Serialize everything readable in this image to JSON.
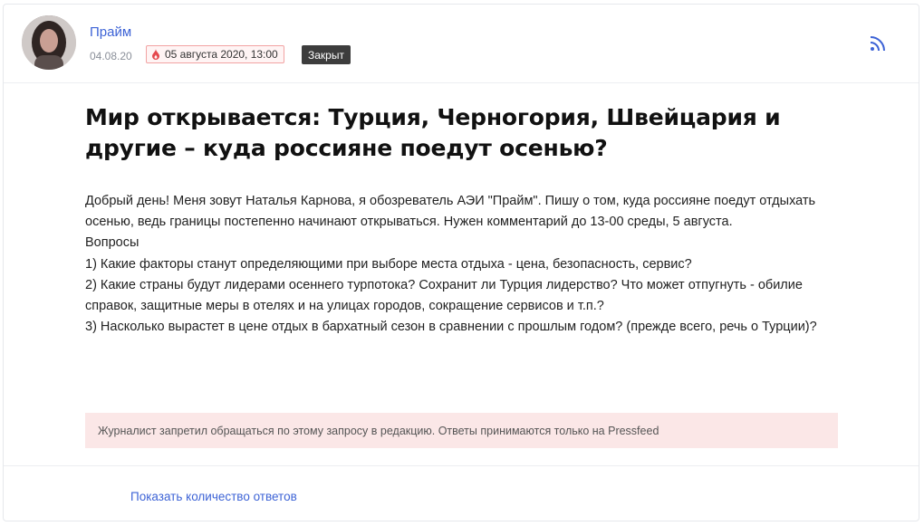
{
  "post": {
    "author": "Прайм",
    "date": "04.08.20",
    "deadline": "05 августа 2020, 13:00",
    "status": "Закрыт",
    "title": "Мир открывается: Турция, Черногория, Швейцария и другие – куда россияне поедут осенью?",
    "body_lines": [
      "Добрый день! Меня зовут Наталья Карнова, я обозреватель АЭИ \"Прайм\". Пишу о том, куда россияне поедут отдыхать осенью, ведь границы постепенно начинают открываться. Нужен комментарий до 13-00 среды, 5 августа.",
      "Вопросы",
      "1) Какие факторы станут определяющими при выборе места отдыха - цена, безопасность, сервис?",
      "2) Какие страны будут лидерами осеннего турпотока? Сохранит ли Турция лидерство? Что может отпугнуть - обилие справок, защитные меры в отелях и на улицах городов, сокращение сервисов и т.п.?",
      "3) Насколько вырастет в цене отдых в бархатный сезон в сравнении с прошлым годом? (прежде всего, речь о Турции)?"
    ],
    "notice": "Журналист запретил обращаться по этому запросу в редакцию. Ответы принимаются только на Pressfeed",
    "show_answers_label": "Показать количество ответов"
  },
  "icons": {
    "avatar": "author-avatar",
    "deadline": "fire-drop-icon",
    "subscribe": "rss-icon"
  },
  "colors": {
    "link": "#3d63d6",
    "badge_closed_bg": "#3d3d3d",
    "deadline_border": "#f2a3a3",
    "notice_bg": "#fbe7e7"
  }
}
